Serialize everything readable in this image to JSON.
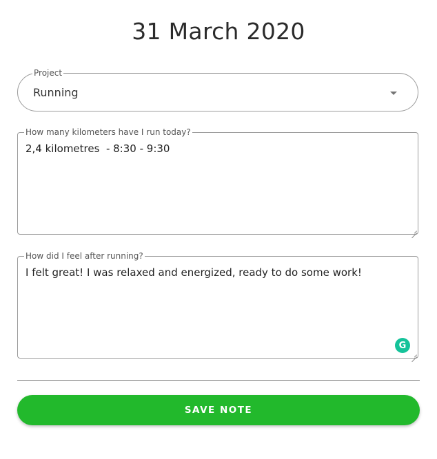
{
  "page": {
    "title": "31 March 2020"
  },
  "project_field": {
    "label": "Project",
    "value": "Running"
  },
  "km_field": {
    "label": "How many kilometers have I run today?",
    "value": "2,4 kilometres  - 8:30 - 9:30"
  },
  "feel_field": {
    "label": "How did I feel after running?",
    "value": "I felt great! I was relaxed and energized, ready to do some work!"
  },
  "grammarly": {
    "icon": "grammarly-icon",
    "glyph": "G",
    "color": "#15c39a"
  },
  "actions": {
    "save_label": "SAVE NOTE",
    "save_color": "#22b92c"
  }
}
